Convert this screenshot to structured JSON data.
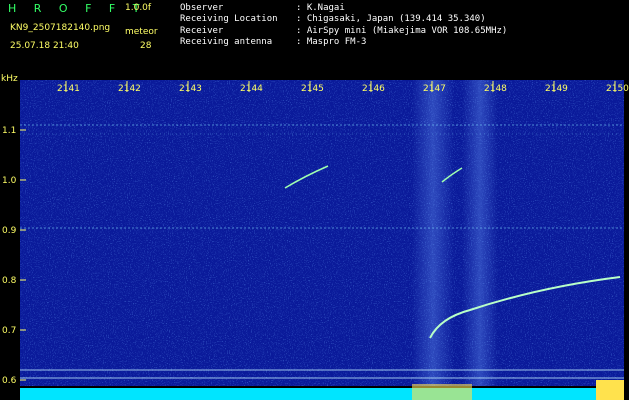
{
  "header": {
    "brand": "H R O F F T",
    "version": "1.0.0f",
    "filename": "KN9_2507182140.png",
    "datetime": "25.07.18 21:40",
    "meteor_label": "meteor",
    "meteor_count": "28",
    "fields": [
      {
        "label": "Observer",
        "value": ": K.Nagai"
      },
      {
        "label": "Receiving Location",
        "value": ": Chigasaki, Japan (139.414 35.340)"
      },
      {
        "label": "Receiver",
        "value": ": AirSpy mini (Miakejima VOR 108.65MHz)"
      },
      {
        "label": "Receiving antenna",
        "value": ": Maspro FM-3"
      }
    ]
  },
  "spectrogram": {
    "unit": "kHz",
    "colors": {
      "background": "#0a1a9a",
      "noise": "#2a5cff",
      "trail": "#9fffb0",
      "tick": "#ffff66",
      "baseline": "#00e5ff"
    },
    "time_labels": [
      "2141",
      "2142",
      "2143",
      "2144",
      "2145",
      "2146",
      "2147",
      "2148",
      "2149",
      "2150"
    ],
    "freq_labels": [
      "1.1",
      "1.0",
      "0.9",
      "0.8",
      "0.7",
      "0.6"
    ]
  }
}
